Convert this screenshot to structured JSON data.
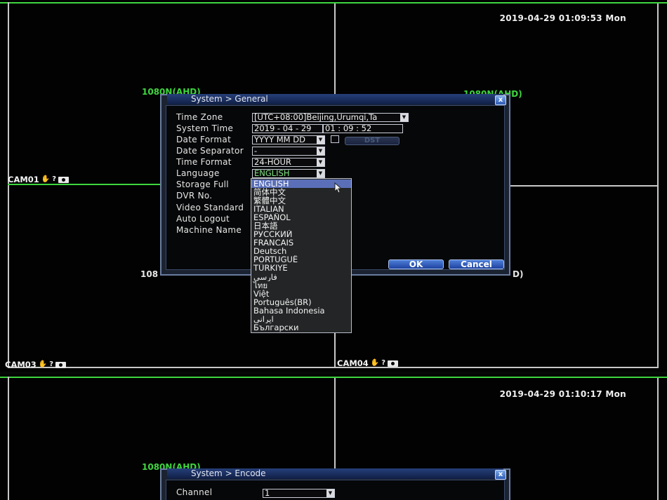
{
  "top": {
    "datetime": "2019-04-29 01:09:53 Mon",
    "res_labels": [
      "1080N(AHD)",
      "1080N(AHD)",
      "108",
      "D)"
    ],
    "cams": {
      "cam1": "CAM01",
      "cam3": "CAM03",
      "cam4": "CAM04"
    },
    "colors": {
      "grid": "#3fd63f",
      "accent": "#2a4fa8"
    }
  },
  "general_dialog": {
    "title": "System > General",
    "close": "x",
    "labels": {
      "time_zone": "Time Zone",
      "system_time": "System Time",
      "date_format": "Date Format",
      "date_separator": "Date Separator",
      "time_format": "Time Format",
      "language": "Language",
      "storage_full": "Storage Full",
      "dvr_no": "DVR No.",
      "video_standard": "Video Standard",
      "auto_logout": "Auto Logout",
      "machine_name": "Machine Name"
    },
    "values": {
      "time_zone": "[UTC+08:00]Beijing,Urumqi,Ta",
      "system_date": "2019 - 04 - 29",
      "system_clock": "01 : 09 : 52",
      "date_format": "YYYY MM DD",
      "date_separator": "-",
      "time_format": "24-HOUR",
      "language": "ENGLISH",
      "dst": "DST"
    },
    "buttons": {
      "ok": "OK",
      "cancel": "Cancel"
    }
  },
  "language_options": [
    "ENGLISH",
    "简体中文",
    "繁體中文",
    "ITALIAN",
    "ESPAÑOL",
    "日本語",
    "РУССКИЙ",
    "FRANCAIS",
    "Deutsch",
    "PORTUGUÊ",
    "TÜRKIYE",
    "فارسی",
    "ไทย",
    "Việt",
    "Português(BR)",
    "Bahasa Indonesia",
    "ایرانی",
    "Български"
  ],
  "bottom": {
    "datetime": "2019-04-29 01:10:17 Mon",
    "res_label": "1080N(AHD)",
    "dialog_title": "System > Encode",
    "channel_label": "Channel",
    "channel_value": "1"
  }
}
